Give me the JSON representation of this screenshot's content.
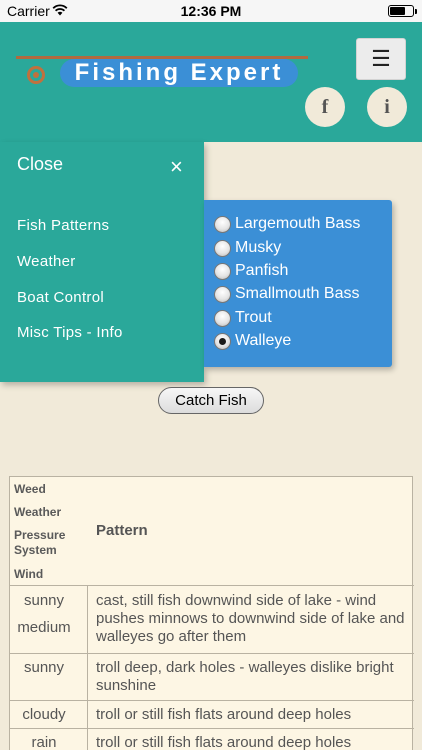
{
  "status_bar": {
    "carrier": "Carrier",
    "time": "12:36 PM"
  },
  "header": {
    "title": "Fishing Expert",
    "menu_icon": "hamburger-icon",
    "facebook_label": "f",
    "info_label": "i"
  },
  "drawer": {
    "close_label": "Close",
    "close_icon": "×",
    "items": [
      "Fish Patterns",
      "Weather",
      "Boat Control",
      "Misc Tips - Info"
    ]
  },
  "fish_options": [
    {
      "label": "Largemouth Bass",
      "selected": false
    },
    {
      "label": "Musky",
      "selected": false
    },
    {
      "label": "Panfish",
      "selected": false
    },
    {
      "label": "Smallmouth Bass",
      "selected": false
    },
    {
      "label": "Trout",
      "selected": false
    },
    {
      "label": "Walleye",
      "selected": true
    }
  ],
  "catch_button": "Catch Fish",
  "table": {
    "headers": {
      "weed": "Weed",
      "weather": "Weather",
      "pressure": "Pressure System",
      "wind": "Wind",
      "pattern": "Pattern"
    },
    "rows": [
      {
        "conditions": [
          "sunny",
          "medium"
        ],
        "pattern": "cast, still fish downwind side of lake - wind pushes minnows to downwind side of lake and walleyes go after them"
      },
      {
        "conditions": [
          "sunny"
        ],
        "pattern": "troll deep, dark holes - walleyes dislike bright sunshine"
      },
      {
        "conditions": [
          "cloudy"
        ],
        "pattern": "troll or still fish flats around deep holes"
      },
      {
        "conditions": [
          "rain"
        ],
        "pattern": "troll or still fish flats around deep holes"
      }
    ]
  }
}
